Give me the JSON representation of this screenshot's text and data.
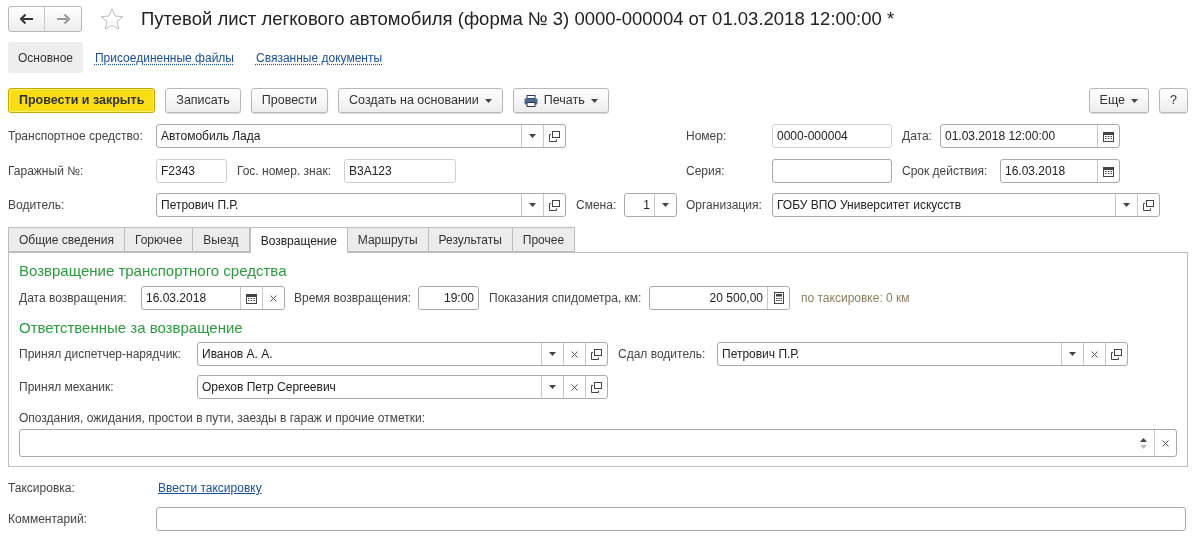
{
  "window": {
    "title": "Путевой лист легкового автомобиля (форма № 3) 0000-000004 от 01.03.2018 12:00:00 *"
  },
  "sections": [
    {
      "label": "Основное",
      "selected": true
    },
    {
      "label": "Присоединенные файлы",
      "selected": false
    },
    {
      "label": "Связанные документы",
      "selected": false
    }
  ],
  "toolbar": {
    "buttons": [
      {
        "label": "Провести и закрыть",
        "kind": "primary"
      },
      {
        "label": "Записать",
        "kind": "plain"
      },
      {
        "label": "Провести",
        "kind": "plain"
      },
      {
        "label": "Создать на основании",
        "kind": "menu"
      },
      {
        "label": "Печать",
        "kind": "print"
      }
    ],
    "right_buttons": [
      {
        "label": "Еще",
        "kind": "menu"
      },
      {
        "label": "?",
        "kind": "plain"
      }
    ]
  },
  "header": {
    "vehicle": {
      "label": "Транспортное средство:",
      "value": "Автомобиль Лада"
    },
    "number": {
      "label": "Номер:",
      "value": "0000-000004"
    },
    "date": {
      "label": "Дата:",
      "value": "01.03.2018 12:00:00"
    },
    "garage_no": {
      "label": "Гаражный №:",
      "value": "F2343"
    },
    "plate": {
      "label": "Гос. номер. знак:",
      "value": "В3А123"
    },
    "series": {
      "label": "Серия:"
    },
    "valid_until": {
      "label": "Срок действия:",
      "value": "16.03.2018"
    },
    "driver": {
      "label": "Водитель:",
      "value": "Петрович П.Р."
    },
    "shift": {
      "label": "Смена:",
      "value": "1"
    },
    "organization": {
      "label": "Организация:",
      "value": "ГОБУ ВПО Университет искусств"
    }
  },
  "tabs": [
    {
      "label": "Общие сведения",
      "selected": false
    },
    {
      "label": "Горючее",
      "selected": false
    },
    {
      "label": "Выезд",
      "selected": false
    },
    {
      "label": "Возвращение",
      "selected": true
    },
    {
      "label": "Маршруты",
      "selected": false
    },
    {
      "label": "Результаты",
      "selected": false
    },
    {
      "label": "Прочее",
      "selected": false
    }
  ],
  "return_section": {
    "title": "Возвращение транспортного средства",
    "return_date": {
      "label": "Дата возвращения:",
      "value": "16.03.2018"
    },
    "return_time": {
      "label": "Время возвращения:",
      "value": "19:00"
    },
    "odometer": {
      "label": "Показания спидометра, км:",
      "value": "20 500,00"
    },
    "by_taxing": "по таксировке: 0 км"
  },
  "responsible": {
    "title": "Ответственные за возвращение",
    "dispatcher": {
      "label": "Принял диспетчер-нарядчик:",
      "value": "Иванов А. А."
    },
    "driver_handed": {
      "label": "Сдал водитель:",
      "value": "Петрович П.Р."
    },
    "mechanic": {
      "label": "Принял механик:",
      "value": "Орехов Петр Сергеевич"
    }
  },
  "notes": {
    "label": "Опоздания, ожидания, простои в пути, заезды в гараж и прочие отметки:"
  },
  "taxing": {
    "label": "Таксировка:",
    "link": "Ввести таксировку"
  },
  "comment": {
    "label": "Комментарий:"
  }
}
